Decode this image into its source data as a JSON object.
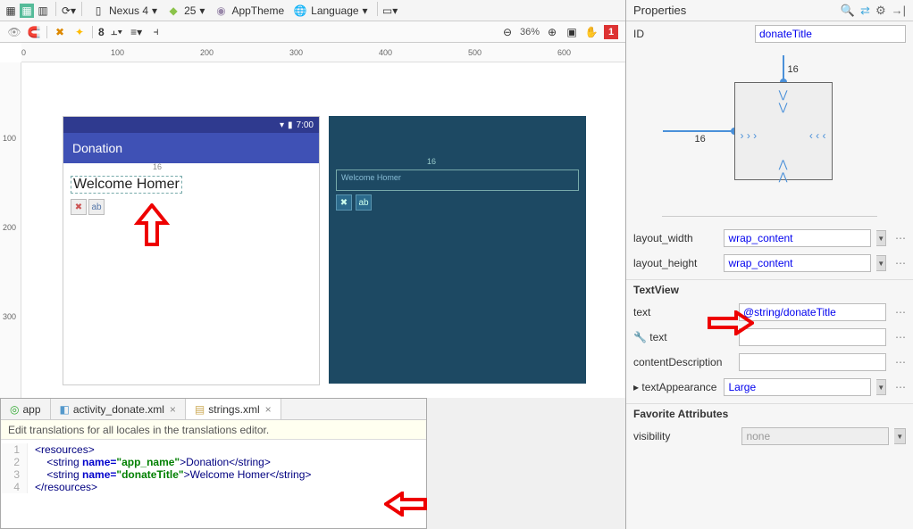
{
  "toolbar": {
    "device": "Nexus 4",
    "api": "25",
    "theme": "AppTheme",
    "lang": "Language"
  },
  "toolbar2": {
    "zoom_value": "8",
    "zoom_pct": "36%",
    "warnings": "1"
  },
  "ruler_h": [
    "0",
    "100",
    "200",
    "300",
    "400",
    "500",
    "600"
  ],
  "ruler_v": [
    "100",
    "200",
    "300"
  ],
  "device_preview": {
    "time": "7:00",
    "app_title": "Donation",
    "welcome_text": "Welcome Homer",
    "margin_hint": "16",
    "blueprint_label": "Welcome Homer",
    "bp_margin": "16"
  },
  "tabs": {
    "t1": "app",
    "t2": "activity_donate.xml",
    "t3": "strings.xml"
  },
  "info_bar": "Edit translations for all locales in the translations editor.",
  "code_lines": [
    "1",
    "2",
    "3",
    "4"
  ],
  "code": {
    "resources_open": "<resources>",
    "s1_open": "    <string ",
    "s1_nameattr": "name=",
    "s1_name": "\"app_name\"",
    "s1_mid": ">Donation</string>",
    "s2_open": "    <string ",
    "s2_nameattr": "name=",
    "s2_name": "\"donateTitle\"",
    "s2_mid": ">Welcome Homer</string>",
    "resources_close": "</resources>"
  },
  "props": {
    "header": "Properties",
    "id_label": "ID",
    "id_value": "donateTitle",
    "constraint_top": "16",
    "constraint_left": "16",
    "lw_label": "layout_width",
    "lw_value": "wrap_content",
    "lh_label": "layout_height",
    "lh_value": "wrap_content",
    "section_tv": "TextView",
    "text_label": "text",
    "text_value": "@string/donateTitle",
    "text2_label": "text",
    "cd_label": "contentDescription",
    "ta_label": "textAppearance",
    "ta_value": "Large",
    "section_fav": "Favorite Attributes",
    "vis_label": "visibility",
    "vis_value": "none"
  }
}
